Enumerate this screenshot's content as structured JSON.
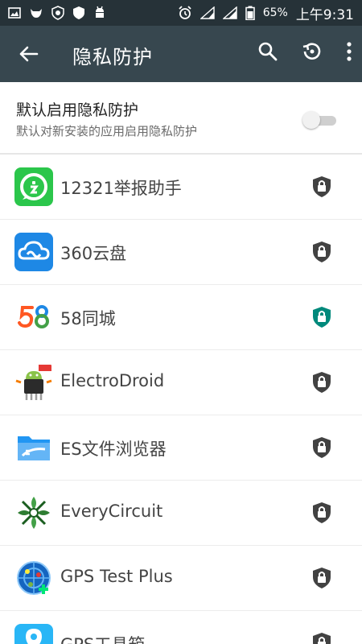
{
  "status_bar": {
    "battery": "65%",
    "time": "上午9:31"
  },
  "app_bar": {
    "title": "隐私防护",
    "back_icon": "arrow-left-icon",
    "search_icon": "search-icon",
    "history_icon": "history-icon",
    "menu_icon": "more-vert-icon"
  },
  "settings": {
    "title": "默认启用隐私防护",
    "subtitle": "默认对新安装的应用启用隐私防护",
    "toggle_on": false
  },
  "apps": [
    {
      "name": "12321举报助手",
      "icon": "shield-green-app-icon",
      "protected": false
    },
    {
      "name": "360云盘",
      "icon": "cloud-app-icon",
      "protected": false
    },
    {
      "name": "58同城",
      "icon": "58-app-icon",
      "protected": true
    },
    {
      "name": "ElectroDroid",
      "icon": "electrodroid-app-icon",
      "protected": false
    },
    {
      "name": "ES文件浏览器",
      "icon": "folder-app-icon",
      "protected": false
    },
    {
      "name": "EveryCircuit",
      "icon": "circuit-app-icon",
      "protected": false
    },
    {
      "name": "GPS Test Plus",
      "icon": "gps-test-app-icon",
      "protected": false
    },
    {
      "name": "GPS工具箱",
      "icon": "gps-tools-app-icon",
      "protected": false
    }
  ],
  "colors": {
    "status_bar": "#263238",
    "app_bar": "#37474f",
    "shield_default": "#424242",
    "shield_protected": "#00897b"
  }
}
